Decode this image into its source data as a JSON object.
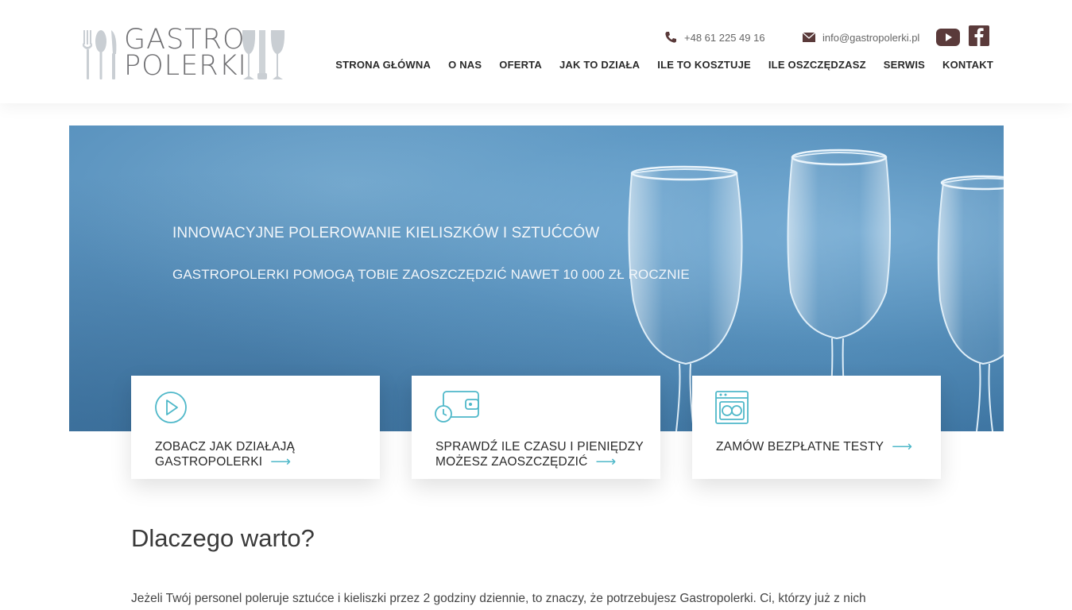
{
  "logo": {
    "line1": "GASTRO",
    "line2": "POLERKI"
  },
  "contact": {
    "phone": "+48 61 225 49 16",
    "email": "info@gastropolerki.pl"
  },
  "social": {
    "youtube": "youtube-icon",
    "facebook": "facebook-icon"
  },
  "nav": [
    {
      "label": "STRONA GŁÓWNA"
    },
    {
      "label": "O NAS"
    },
    {
      "label": "OFERTA"
    },
    {
      "label": "JAK TO DZIAŁA"
    },
    {
      "label": "ILE TO KOSZTUJE"
    },
    {
      "label": "ILE OSZCZĘDZASZ"
    },
    {
      "label": "SERWIS"
    },
    {
      "label": "KONTAKT"
    }
  ],
  "hero": {
    "title": "INNOWACYJNE POLEROWANIE KIELISZKÓW I SZTUĆCÓW",
    "subtitle": "GASTROPOLERKI POMOGĄ TOBIE ZAOSZCZĘDZIĆ NAWET 10 000 ZŁ ROCZNIE"
  },
  "cards": [
    {
      "line1": "ZOBACZ JAK DZIAŁAJĄ",
      "line2": "GASTROPOLERKI",
      "icon": "play-icon"
    },
    {
      "line1": "SPRAWDŹ ILE CZASU I PIENIĘDZY",
      "line2": "MOŻESZ ZAOSZCZĘDZIĆ",
      "icon": "wallet-clock-icon"
    },
    {
      "line1": "ZAMÓW BEZPŁATNE TESTY",
      "icon": "dishwasher-icon"
    }
  ],
  "section": {
    "title": "Dlaczego warto?",
    "body": "Jeżeli Twój personel poleruje sztućce i kieliszki przez 2 godziny dziennie, to znaczy, że potrzebujesz Gastropolerki. Ci, którzy już z nich"
  },
  "colors": {
    "accent": "#4fb8c9",
    "brand_dark": "#5a3a3a",
    "hero_blue": "#5a93bf"
  }
}
